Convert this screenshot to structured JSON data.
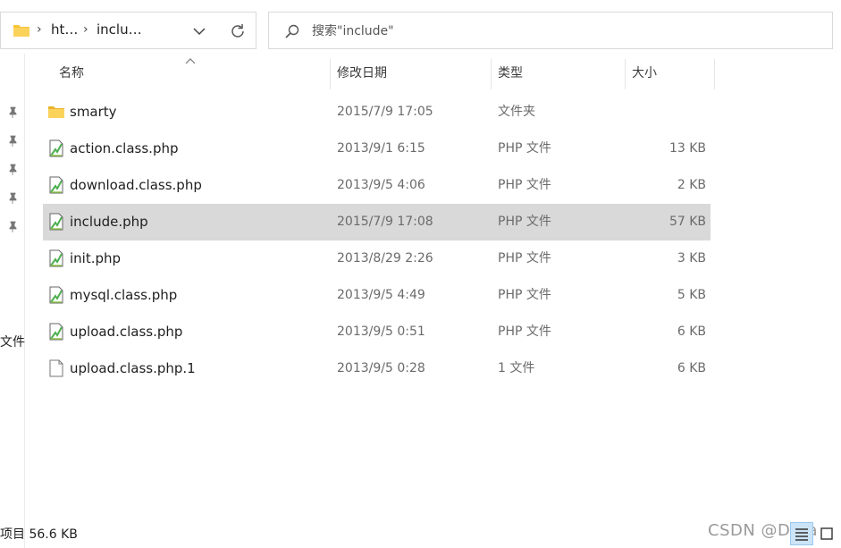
{
  "address": {
    "crumbs": [
      "ht…",
      "inclu…"
    ]
  },
  "search": {
    "placeholder": "搜索\"include\""
  },
  "nav": {
    "cut_label": "文件"
  },
  "columns": {
    "name": "名称",
    "date": "修改日期",
    "type": "类型",
    "size": "大小"
  },
  "files": [
    {
      "name": "smarty",
      "date": "2015/7/9 17:05",
      "type": "文件夹",
      "size": "",
      "icon": "folder-icon"
    },
    {
      "name": "action.class.php",
      "date": "2013/9/1 6:15",
      "type": "PHP 文件",
      "size": "13 KB",
      "icon": "php-file-icon"
    },
    {
      "name": "download.class.php",
      "date": "2013/9/5 4:06",
      "type": "PHP 文件",
      "size": "2 KB",
      "icon": "php-file-icon"
    },
    {
      "name": "include.php",
      "date": "2015/7/9 17:08",
      "type": "PHP 文件",
      "size": "57 KB",
      "icon": "php-file-icon",
      "selected": true
    },
    {
      "name": "init.php",
      "date": "2013/8/29 2:26",
      "type": "PHP 文件",
      "size": "3 KB",
      "icon": "php-file-icon"
    },
    {
      "name": "mysql.class.php",
      "date": "2013/9/5 4:49",
      "type": "PHP 文件",
      "size": "5 KB",
      "icon": "php-file-icon"
    },
    {
      "name": "upload.class.php",
      "date": "2013/9/5 0:51",
      "type": "PHP 文件",
      "size": "6 KB",
      "icon": "php-file-icon"
    },
    {
      "name": "upload.class.php.1",
      "date": "2013/9/5 0:28",
      "type": "1 文件",
      "size": "6 KB",
      "icon": "blank-file-icon"
    }
  ],
  "status": {
    "text": "项目  56.6 KB"
  },
  "watermark": "CSDN @Deta",
  "colors": {
    "selection": "#d9d9d9",
    "folder": "#f8c53a",
    "php_icon_green": "#4caf50"
  }
}
